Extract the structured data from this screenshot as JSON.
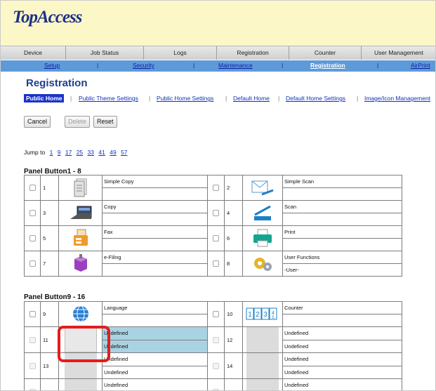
{
  "brand": {
    "logo": "TopAccess"
  },
  "tabs": [
    {
      "label": "Device",
      "active": false
    },
    {
      "label": "Job Status",
      "active": false
    },
    {
      "label": "Logs",
      "active": false
    },
    {
      "label": "Registration",
      "active": false
    },
    {
      "label": "Counter",
      "active": false
    },
    {
      "label": "User Management",
      "active": false
    }
  ],
  "subnav": {
    "items": [
      "Setup",
      "Security",
      "Maintenance",
      "Registration",
      "AirPrint"
    ],
    "separator": "|",
    "current": "Registration"
  },
  "page": {
    "title": "Registration",
    "subtabs": [
      "Public Home",
      "Public Theme Settings",
      "Public Home Settings",
      "Default Home",
      "Default Home Settings",
      "Image/Icon Management"
    ],
    "subtab_separator": "|",
    "current_subtab": "Public Home"
  },
  "actions": {
    "cancel": "Cancel",
    "delete": "Delete",
    "reset": "Reset"
  },
  "jump": {
    "label": "Jump to",
    "links": [
      "1",
      "9",
      "17",
      "25",
      "33",
      "41",
      "49",
      "57"
    ]
  },
  "panel1": {
    "title": "Panel Button1 - 8",
    "rows": [
      {
        "left": {
          "num": "1",
          "label": "Simple Copy",
          "sub": "",
          "icon": "simple-copy-icon"
        },
        "right": {
          "num": "2",
          "label": "Simple Scan",
          "sub": "",
          "icon": "simple-scan-icon"
        }
      },
      {
        "left": {
          "num": "3",
          "label": "Copy",
          "sub": "",
          "icon": "copy-icon"
        },
        "right": {
          "num": "4",
          "label": "Scan",
          "sub": "",
          "icon": "scan-icon"
        }
      },
      {
        "left": {
          "num": "5",
          "label": "Fax",
          "sub": "",
          "icon": "fax-icon"
        },
        "right": {
          "num": "6",
          "label": "Print",
          "sub": "",
          "icon": "print-icon"
        }
      },
      {
        "left": {
          "num": "7",
          "label": "e-Filing",
          "sub": "",
          "icon": "e-filing-icon"
        },
        "right": {
          "num": "8",
          "label": "User Functions",
          "sub": "-User-",
          "icon": "user-functions-icon"
        }
      }
    ]
  },
  "panel2": {
    "title": "Panel Button9 - 16",
    "rows": [
      {
        "left": {
          "num": "9",
          "label": "Language",
          "sub": "",
          "icon": "language-icon"
        },
        "right": {
          "num": "10",
          "label": "Counter",
          "sub": "",
          "icon": "counter-icon"
        }
      },
      {
        "left": {
          "num": "11",
          "label": "Undefined",
          "sub": "Undefined",
          "icon": "blank-tile"
        },
        "right": {
          "num": "12",
          "label": "Undefined",
          "sub": "Undefined",
          "icon": "blank-tile"
        }
      },
      {
        "left": {
          "num": "13",
          "label": "Undefined",
          "sub": "Undefined",
          "icon": "blank-tile"
        },
        "right": {
          "num": "14",
          "label": "Undefined",
          "sub": "Undefined",
          "icon": "blank-tile"
        }
      },
      {
        "left": {
          "num": "",
          "label": "Undefined",
          "sub": "",
          "icon": "blank-tile"
        },
        "right": {
          "num": "",
          "label": "Undefined",
          "sub": "",
          "icon": "blank-tile"
        }
      }
    ]
  },
  "counter_icon_text": "1 2 3 4/5",
  "colors": {
    "header_bg": "#fcf7c6",
    "subnav_bg": "#5f9ad8",
    "highlight": "#a9d3e3",
    "focus_ring": "#e21d1d",
    "title_blue": "#1f3f8a"
  }
}
